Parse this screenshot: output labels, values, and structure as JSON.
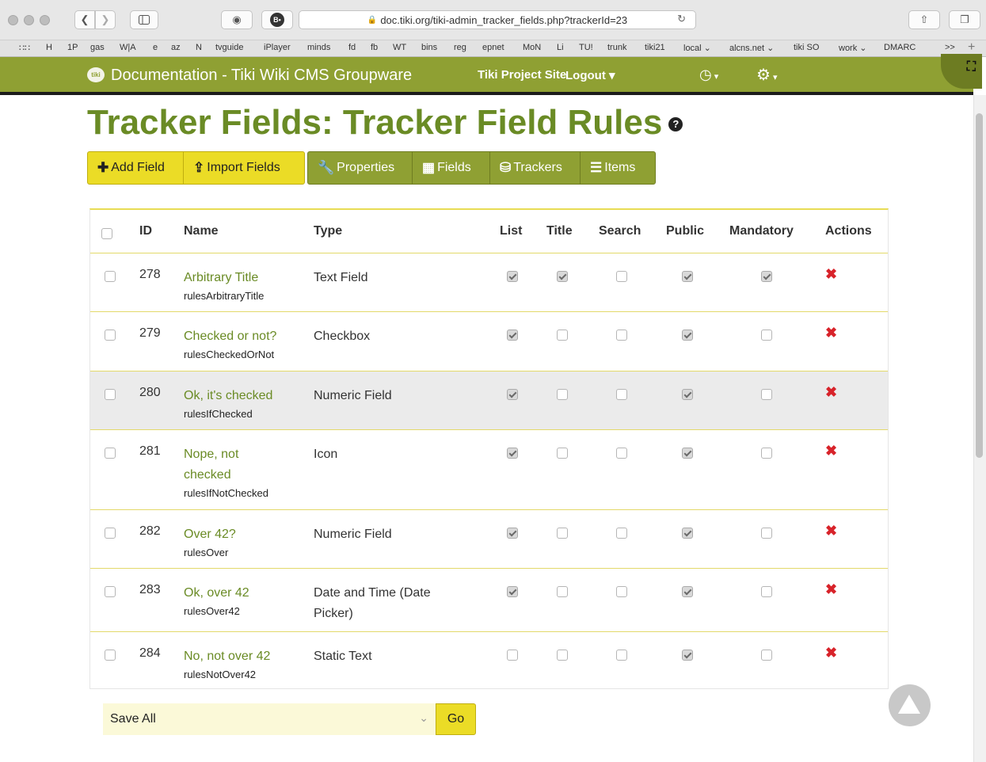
{
  "browser": {
    "url": "doc.tiki.org/tiki-admin_tracker_fields.php?trackerId=23",
    "bookmarks": [
      "H",
      "1P",
      "gas",
      "W|A",
      "e",
      "az",
      "N",
      "tvguide",
      "iPlayer",
      "minds",
      "fd",
      "fb",
      "WT",
      "bins",
      "reg",
      "epnet",
      "MoN",
      "Li",
      "TU!",
      "trunk",
      "tiki21",
      "local ⌄",
      "alcns.net ⌄",
      "tiki SO",
      "work ⌄",
      "DMARC"
    ],
    "bookmarks_overflow": ">>"
  },
  "site": {
    "logo_text": "tiki",
    "title": "Documentation - Tiki Wiki CMS Groupware",
    "project_menu": "Tiki Project Site",
    "logout": "Logout ▾"
  },
  "page": {
    "title": "Tracker Fields: Tracker Field Rules",
    "help": "?"
  },
  "toolbar": {
    "add_field": "Add Field",
    "import_fields": "Import Fields",
    "properties": "Properties",
    "fields": "Fields",
    "trackers": "Trackers",
    "items": "Items"
  },
  "table": {
    "headers": {
      "id": "ID",
      "name": "Name",
      "type": "Type",
      "list": "List",
      "title": "Title",
      "search": "Search",
      "public": "Public",
      "mandatory": "Mandatory",
      "actions": "Actions"
    },
    "rows": [
      {
        "id": "278",
        "name": "Arbitrary Title",
        "perm": "rulesArbitraryTitle",
        "type": "Text Field",
        "list": true,
        "title": true,
        "search": false,
        "public": true,
        "mandatory": true
      },
      {
        "id": "279",
        "name": "Checked or not?",
        "perm": "rulesCheckedOrNot",
        "type": "Checkbox",
        "list": true,
        "title": false,
        "search": false,
        "public": true,
        "mandatory": false
      },
      {
        "id": "280",
        "name": "Ok, it's checked",
        "perm": "rulesIfChecked",
        "type": "Numeric Field",
        "list": true,
        "title": false,
        "search": false,
        "public": true,
        "mandatory": false,
        "highlighted": true
      },
      {
        "id": "281",
        "name": "Nope, not checked",
        "perm": "rulesIfNotChecked",
        "type": "Icon",
        "list": true,
        "title": false,
        "search": false,
        "public": true,
        "mandatory": false
      },
      {
        "id": "282",
        "name": "Over 42?",
        "perm": "rulesOver",
        "type": "Numeric Field",
        "list": true,
        "title": false,
        "search": false,
        "public": true,
        "mandatory": false
      },
      {
        "id": "283",
        "name": "Ok, over 42",
        "perm": "rulesOver42",
        "type": "Date and Time (Date Picker)",
        "list": true,
        "title": false,
        "search": false,
        "public": true,
        "mandatory": false
      },
      {
        "id": "284",
        "name": "No, not over 42",
        "perm": "rulesNotOver42",
        "type": "Static Text",
        "list": false,
        "title": false,
        "search": false,
        "public": true,
        "mandatory": false
      }
    ],
    "delete_glyph": "✖"
  },
  "bulk": {
    "selected": "Save All",
    "go": "Go"
  },
  "colors": {
    "brand_green": "#8fa033",
    "title_green": "#6a8b25",
    "accent_yellow": "#ebdc26",
    "delete_red": "#d8232a"
  }
}
